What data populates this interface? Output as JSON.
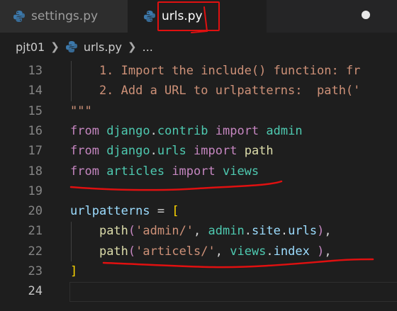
{
  "tabs": [
    {
      "label": "settings.py",
      "active": false
    },
    {
      "label": "urls.py",
      "active": true,
      "unsaved": true
    }
  ],
  "breadcrumb": {
    "folder": "pjt01",
    "file": "urls.py",
    "more": "..."
  },
  "lines": [
    {
      "num": "13",
      "segments": [
        {
          "t": "    1. Import the include() function: fr",
          "c": "c-str"
        }
      ]
    },
    {
      "num": "14",
      "segments": [
        {
          "t": "    2. Add a URL to urlpatterns:  path('",
          "c": "c-str"
        }
      ]
    },
    {
      "num": "15",
      "segments": [
        {
          "t": "\"\"\"",
          "c": "c-str"
        }
      ]
    },
    {
      "num": "16",
      "segments": [
        {
          "t": "from",
          "c": "c-kw"
        },
        {
          "t": " django",
          "c": "c-mod"
        },
        {
          "t": ".",
          "c": "c-txt"
        },
        {
          "t": "contrib",
          "c": "c-mod"
        },
        {
          "t": " import",
          "c": "c-kw"
        },
        {
          "t": " admin",
          "c": "c-mod"
        }
      ]
    },
    {
      "num": "17",
      "segments": [
        {
          "t": "from",
          "c": "c-kw"
        },
        {
          "t": " django",
          "c": "c-mod"
        },
        {
          "t": ".",
          "c": "c-txt"
        },
        {
          "t": "urls",
          "c": "c-mod"
        },
        {
          "t": " import",
          "c": "c-kw"
        },
        {
          "t": " path",
          "c": "c-fn"
        }
      ]
    },
    {
      "num": "18",
      "segments": [
        {
          "t": "from",
          "c": "c-kw"
        },
        {
          "t": " articles",
          "c": "c-mod"
        },
        {
          "t": " import",
          "c": "c-kw"
        },
        {
          "t": " views",
          "c": "c-mod"
        }
      ]
    },
    {
      "num": "19",
      "segments": []
    },
    {
      "num": "20",
      "segments": [
        {
          "t": "urlpatterns",
          "c": "c-var"
        },
        {
          "t": " = ",
          "c": "c-txt"
        },
        {
          "t": "[",
          "c": "c-br"
        }
      ]
    },
    {
      "num": "21",
      "segments": [
        {
          "t": "    ",
          "c": "c-txt"
        },
        {
          "t": "path",
          "c": "c-fn"
        },
        {
          "t": "(",
          "c": "c-kw"
        },
        {
          "t": "'admin/'",
          "c": "c-str"
        },
        {
          "t": ", ",
          "c": "c-txt"
        },
        {
          "t": "admin",
          "c": "c-mod"
        },
        {
          "t": ".",
          "c": "c-txt"
        },
        {
          "t": "site",
          "c": "c-var"
        },
        {
          "t": ".",
          "c": "c-txt"
        },
        {
          "t": "urls",
          "c": "c-var"
        },
        {
          "t": ")",
          "c": "c-kw"
        },
        {
          "t": ",",
          "c": "c-txt"
        }
      ]
    },
    {
      "num": "22",
      "segments": [
        {
          "t": "    ",
          "c": "c-txt"
        },
        {
          "t": "path",
          "c": "c-fn"
        },
        {
          "t": "(",
          "c": "c-kw"
        },
        {
          "t": "'articels/'",
          "c": "c-str"
        },
        {
          "t": ", ",
          "c": "c-txt"
        },
        {
          "t": "views",
          "c": "c-mod"
        },
        {
          "t": ".",
          "c": "c-txt"
        },
        {
          "t": "index",
          "c": "c-var"
        },
        {
          "t": " ",
          "c": "c-txt"
        },
        {
          "t": ")",
          "c": "c-kw"
        },
        {
          "t": ",",
          "c": "c-txt"
        }
      ]
    },
    {
      "num": "23",
      "segments": [
        {
          "t": "]",
          "c": "c-br"
        }
      ]
    },
    {
      "num": "24",
      "segments": [],
      "current": true
    }
  ],
  "colors": {
    "annotation": "#e01010",
    "background": "#1e1e1e"
  },
  "icons": {
    "file": "python-icon"
  }
}
